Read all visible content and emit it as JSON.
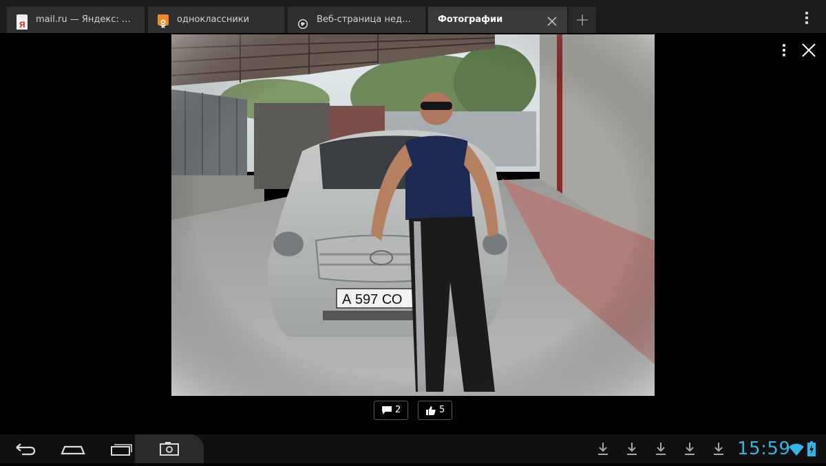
{
  "tabs": [
    {
      "title": "mail.ru — Яндекс: нашл…",
      "icon": "yandex-icon",
      "color": "#e8e8e8"
    },
    {
      "title": "одноклассники",
      "icon": "odnoklassniki-icon",
      "color": "#f0892a"
    },
    {
      "title": "Веб-страница недоступ…",
      "icon": "globe-icon",
      "color": "#d0d0d0"
    },
    {
      "title": "Фотографии",
      "icon": "none",
      "active": true
    }
  ],
  "photo": {
    "description_icon": "photo"
  },
  "counters": {
    "comments": "2",
    "likes": "5"
  },
  "system": {
    "clock": "15:59",
    "accent": "#33b5e5"
  }
}
